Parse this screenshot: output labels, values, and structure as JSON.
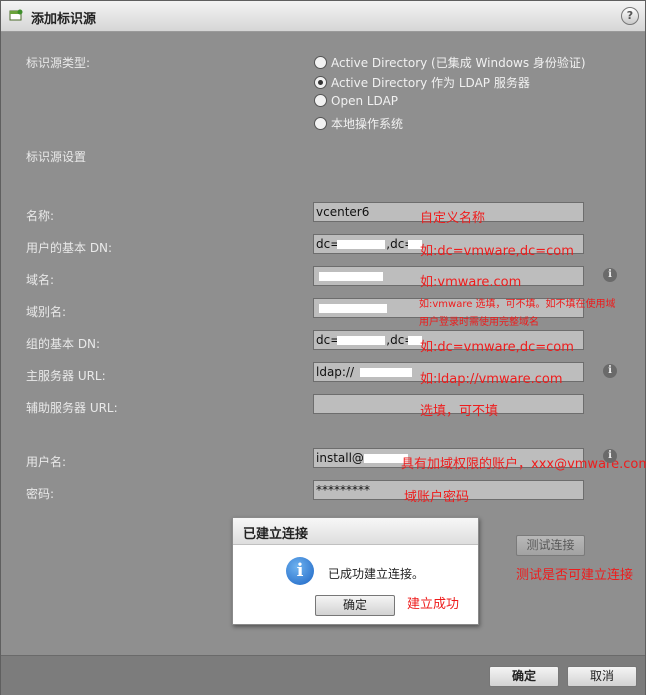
{
  "window": {
    "title": "添加标识源",
    "help_label": "?"
  },
  "section_type": {
    "label": "标识源类型:",
    "options": [
      {
        "label": "Active Directory (已集成 Windows 身份验证)",
        "selected": false
      },
      {
        "label": "Active Directory 作为 LDAP 服务器",
        "selected": true
      },
      {
        "label": "Open LDAP",
        "selected": false
      },
      {
        "label": "本地操作系统",
        "selected": false
      }
    ]
  },
  "section_settings": {
    "label": "标识源设置"
  },
  "fields": {
    "name": {
      "label": "名称:",
      "value": "vcenter6",
      "note": "自定义名称"
    },
    "base_dn_users": {
      "label": "用户的基本 DN:",
      "value": "dc=",
      "value2": ",dc=",
      "note": "如:dc=vmware,dc=com"
    },
    "domain": {
      "label": "域名:",
      "value": "",
      "note": "如:vmware.com"
    },
    "alias": {
      "label": "域别名:",
      "value": "",
      "note_line1": "如:vmware 选填，可不填。如不填在使用域",
      "note_line2": "用户登录时需使用完整域名"
    },
    "base_dn_groups": {
      "label": "组的基本 DN:",
      "value": "dc=",
      "value2": ",dc=",
      "note": "如:dc=vmware,dc=com"
    },
    "primary_url": {
      "label": "主服务器 URL:",
      "value": "ldap://",
      "note": "如:ldap://vmware.com"
    },
    "secondary_url": {
      "label": "辅助服务器 URL:",
      "value": "",
      "note": "选填，可不填"
    },
    "username": {
      "label": "用户名:",
      "value": "install@",
      "note": "具有加域权限的账户，xxx@vmware.com"
    },
    "password": {
      "label": "密码:",
      "value": "*********",
      "note": "域账户密码"
    }
  },
  "info_icon_glyph": "i",
  "test_connection": {
    "label": "测试连接",
    "note": "测试是否可建立连接"
  },
  "dialog": {
    "title": "已建立连接",
    "message": "已成功建立连接。",
    "ok_label": "确定",
    "note": "建立成功",
    "icon_glyph": "i"
  },
  "footer": {
    "ok_label": "确定",
    "cancel_label": "取消"
  },
  "colors": {
    "annotation": "#ee1c1c",
    "background": "#8f8f8f",
    "accent_icon": "#1c64c4"
  }
}
